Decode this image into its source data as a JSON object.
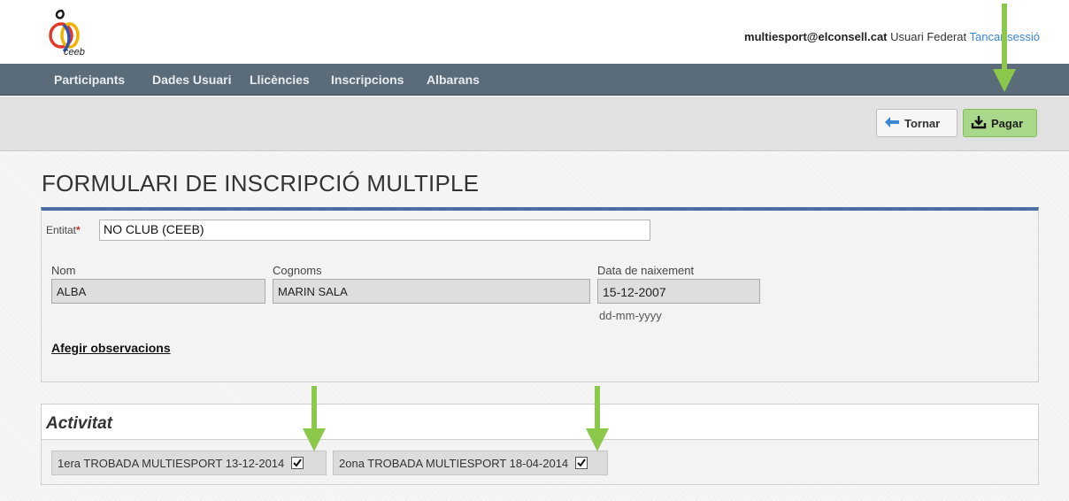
{
  "header": {
    "logo_text": "ceeb",
    "user_email": "multiesport@elconsell.cat",
    "user_role": "Usuari Federat",
    "logout_label": "Tancar sessió"
  },
  "nav": {
    "items": [
      {
        "label": "Participants"
      },
      {
        "label": "Dades Usuari"
      },
      {
        "label": "Llicències"
      },
      {
        "label": "Inscripcions"
      },
      {
        "label": "Albarans"
      }
    ]
  },
  "toolbar": {
    "back_label": "Tornar",
    "pay_label": "Pagar"
  },
  "form": {
    "title": "FORMULARI DE INSCRIPCIÓ MULTIPLE",
    "entitat_label": "Entitat",
    "entitat_required": "*",
    "entitat_value": "NO CLUB (CEEB)",
    "nom_label": "Nom",
    "nom_value": "ALBA",
    "cognoms_label": "Cognoms",
    "cognoms_value": "MARIN SALA",
    "birth_label": "Data de naixement",
    "birth_value": "15-12-2007",
    "birth_hint": "dd-mm-yyyy",
    "observations_link": "Afegir observacions"
  },
  "activity": {
    "title": "Activitat",
    "items": [
      {
        "label": "1era TROBADA MULTIESPORT 13-12-2014",
        "checked": true
      },
      {
        "label": "2ona TROBADA MULTIESPORT 18-04-2014",
        "checked": true
      }
    ]
  },
  "colors": {
    "nav_bg": "#5a6b7a",
    "accent_blue": "#4a6fa5",
    "pay_green": "#a9d88a",
    "arrow_green": "#8cc84b",
    "link_blue": "#3a87d6"
  },
  "icons": {
    "back": "arrow-left-icon",
    "pay": "download-icon",
    "check": "checkmark-icon",
    "annotation": "arrow-down-icon"
  }
}
